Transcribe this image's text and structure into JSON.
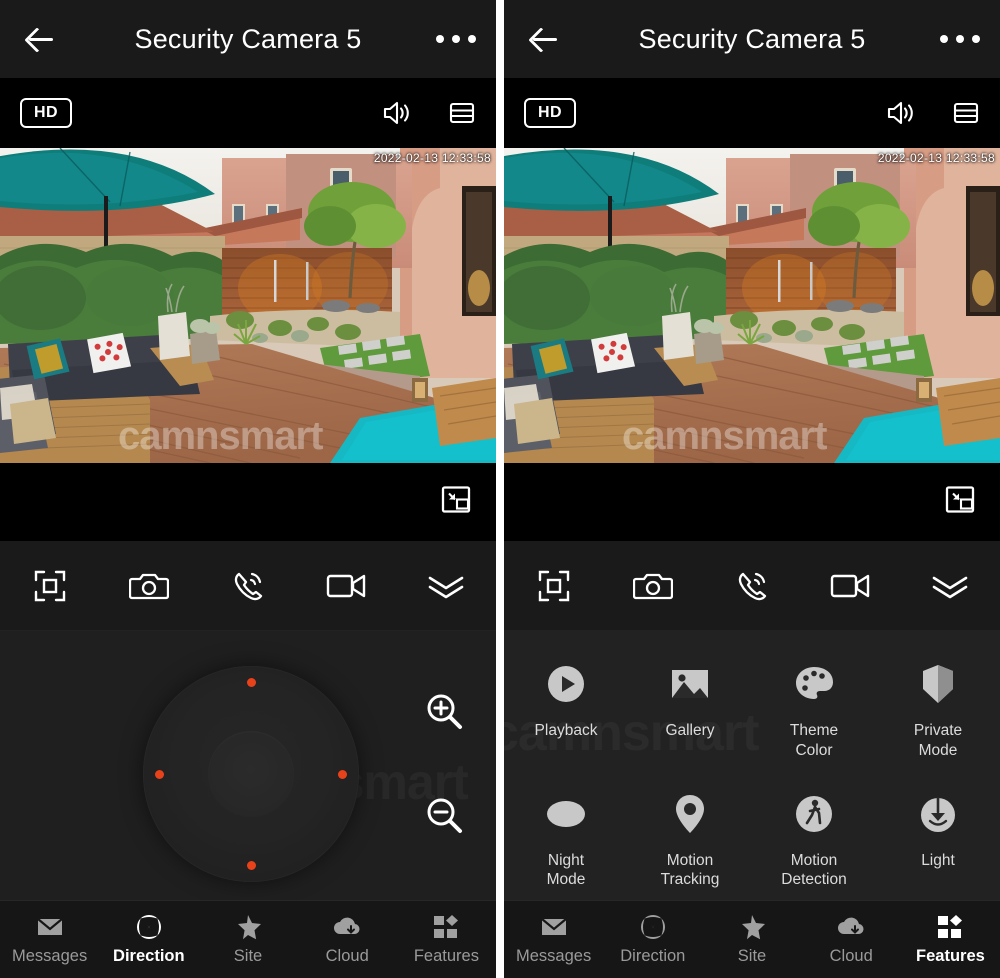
{
  "app": {
    "watermark": "camnsmart",
    "accent_orange": "#e8421a",
    "header_bg": "#1a1a1a",
    "panel_bg": "#1f1f1f"
  },
  "header": {
    "title": "Security Camera 5",
    "back_icon": "back-arrow-icon",
    "menu_icon": "more-options-icon"
  },
  "stream_bar": {
    "quality_badge": "HD",
    "volume_icon": "speaker-icon",
    "layout_icon": "layout-list-icon"
  },
  "video": {
    "timestamp": "2022-02-13  12:33:58",
    "pip_icon": "picture-in-picture-icon"
  },
  "toolbar": {
    "items": [
      {
        "name": "fullscreen-focus",
        "icon": "fullscreen-focus-icon"
      },
      {
        "name": "snapshot",
        "icon": "camera-icon"
      },
      {
        "name": "two-way-talk",
        "icon": "phone-call-icon"
      },
      {
        "name": "record-video",
        "icon": "video-camera-icon"
      },
      {
        "name": "expand-more",
        "icon": "double-chevron-down-icon"
      }
    ]
  },
  "ptz": {
    "dial_name": "ptz-direction-dial",
    "zoom_in_icon": "zoom-in-icon",
    "zoom_out_icon": "zoom-out-icon",
    "dots": [
      "up",
      "down",
      "left",
      "right"
    ]
  },
  "features": {
    "rows": [
      [
        {
          "label": "Playback",
          "icon": "play-circle-icon"
        },
        {
          "label": "Gallery",
          "icon": "image-icon"
        },
        {
          "label": "Theme\nColor",
          "line1": "Theme",
          "line2": "Color",
          "icon": "palette-icon"
        },
        {
          "label": "Private\nMode",
          "line1": "Private",
          "line2": "Mode",
          "icon": "shield-icon"
        }
      ],
      [
        {
          "label": "Night\nMode",
          "line1": "Night",
          "line2": "Mode",
          "icon": "moon-icon"
        },
        {
          "label": "Motion\nTracking",
          "line1": "Motion",
          "line2": "Tracking",
          "icon": "location-pin-icon"
        },
        {
          "label": "Motion\nDetection",
          "line1": "Motion",
          "line2": "Detection",
          "icon": "walking-person-icon"
        },
        {
          "label": "Light",
          "line1": "Light",
          "line2": "",
          "icon": "lamp-icon"
        }
      ]
    ]
  },
  "nav": {
    "items": [
      {
        "label": "Messages",
        "icon": "envelope-icon"
      },
      {
        "label": "Direction",
        "icon": "direction-cross-icon"
      },
      {
        "label": "Site",
        "icon": "star-icon"
      },
      {
        "label": "Cloud",
        "icon": "cloud-download-icon"
      },
      {
        "label": "Features",
        "icon": "grid-apps-icon"
      }
    ],
    "left_panel_active": "Direction",
    "right_panel_active": "Features"
  }
}
